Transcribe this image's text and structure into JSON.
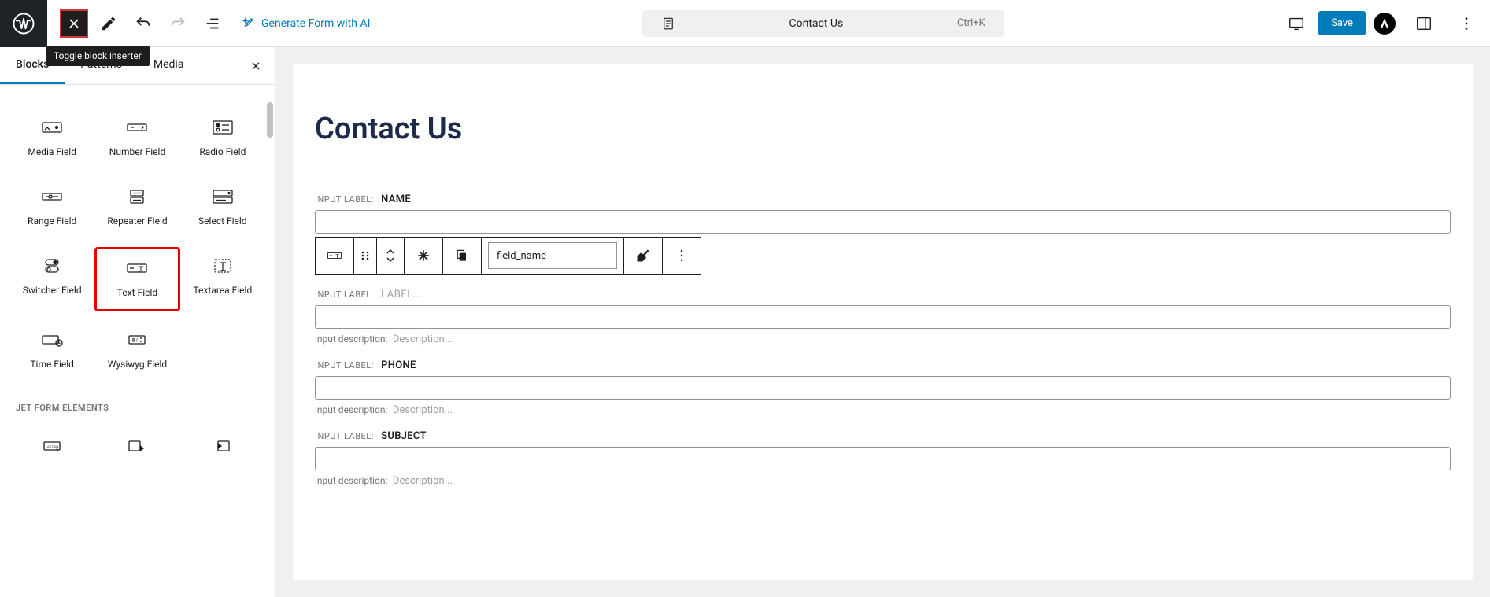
{
  "tooltip": "Toggle block inserter",
  "ai_generate": "Generate Form with AI",
  "document_title": "Contact Us",
  "shortcut": "Ctrl+K",
  "save_label": "Save",
  "tabs": {
    "blocks": "Blocks",
    "patterns": "Patterns",
    "media": "Media"
  },
  "blocks": [
    {
      "label": "Media Field"
    },
    {
      "label": "Number Field"
    },
    {
      "label": "Radio Field"
    },
    {
      "label": "Range Field"
    },
    {
      "label": "Repeater Field"
    },
    {
      "label": "Select Field"
    },
    {
      "label": "Switcher Field"
    },
    {
      "label": "Text Field"
    },
    {
      "label": "Textarea Field"
    },
    {
      "label": "Time Field"
    },
    {
      "label": "Wysiwyg Field"
    }
  ],
  "section_title": "JET FORM ELEMENTS",
  "canvas": {
    "title": "Contact Us",
    "input_label_prefix": "INPUT LABEL:",
    "input_desc_prefix": "input description:",
    "desc_placeholder": "Description...",
    "label_placeholder": "LABEL...",
    "fields": [
      {
        "label": "NAME"
      },
      {
        "label": ""
      },
      {
        "label": "PHONE"
      },
      {
        "label": "SUBJECT"
      }
    ],
    "toolbar_input_value": "field_name"
  }
}
